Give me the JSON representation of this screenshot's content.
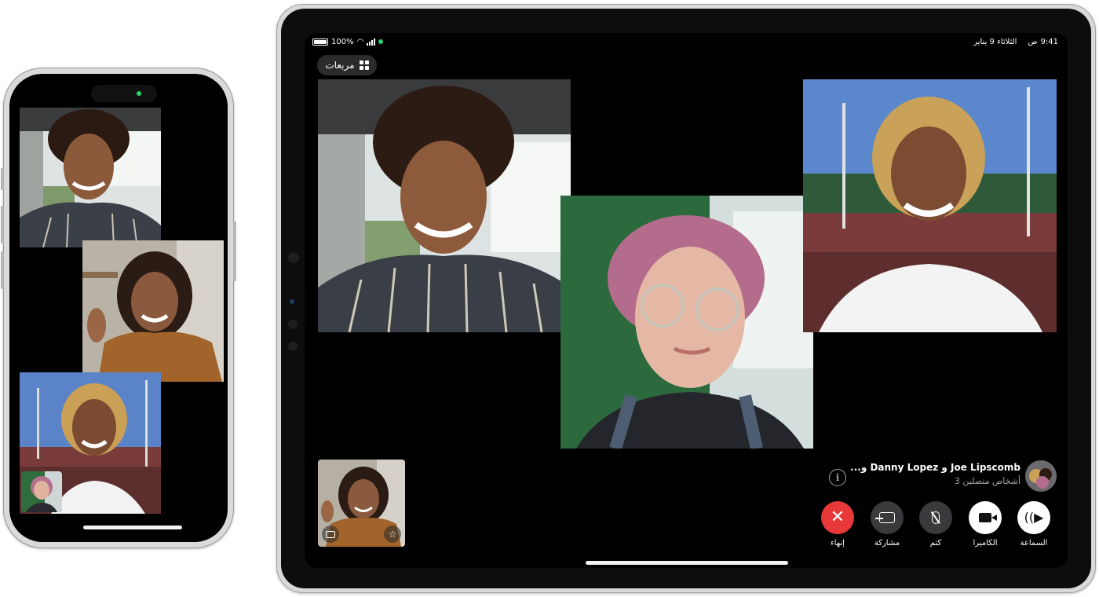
{
  "ipad": {
    "status_bar": {
      "time": "9:41",
      "period": "ص",
      "date": "الثلاثاء 9 يناير",
      "battery": "100%"
    },
    "layout_button_label": "مربعات",
    "call": {
      "title": "Joe Lipscomb و Danny Lopez و...",
      "subtitle": "3 أشخاص متصلين"
    },
    "controls": [
      {
        "label": "إنهاء",
        "icon": "close-icon",
        "color": "#e8383a"
      },
      {
        "label": "مشاركة",
        "icon": "shareplay-icon",
        "color": "#3a3a3c"
      },
      {
        "label": "كتم",
        "icon": "mic-slash-icon",
        "color": "#3a3a3c"
      },
      {
        "label": "الكاميرا",
        "icon": "video-camera-icon",
        "color": "#ffffff"
      },
      {
        "label": "السماعة",
        "icon": "speaker-icon",
        "color": "#ffffff"
      }
    ]
  },
  "colors": {
    "end_call": "#e8383a",
    "control_dark": "#3a3a3c",
    "control_light": "#ffffff",
    "status_green": "#2bd46a"
  }
}
